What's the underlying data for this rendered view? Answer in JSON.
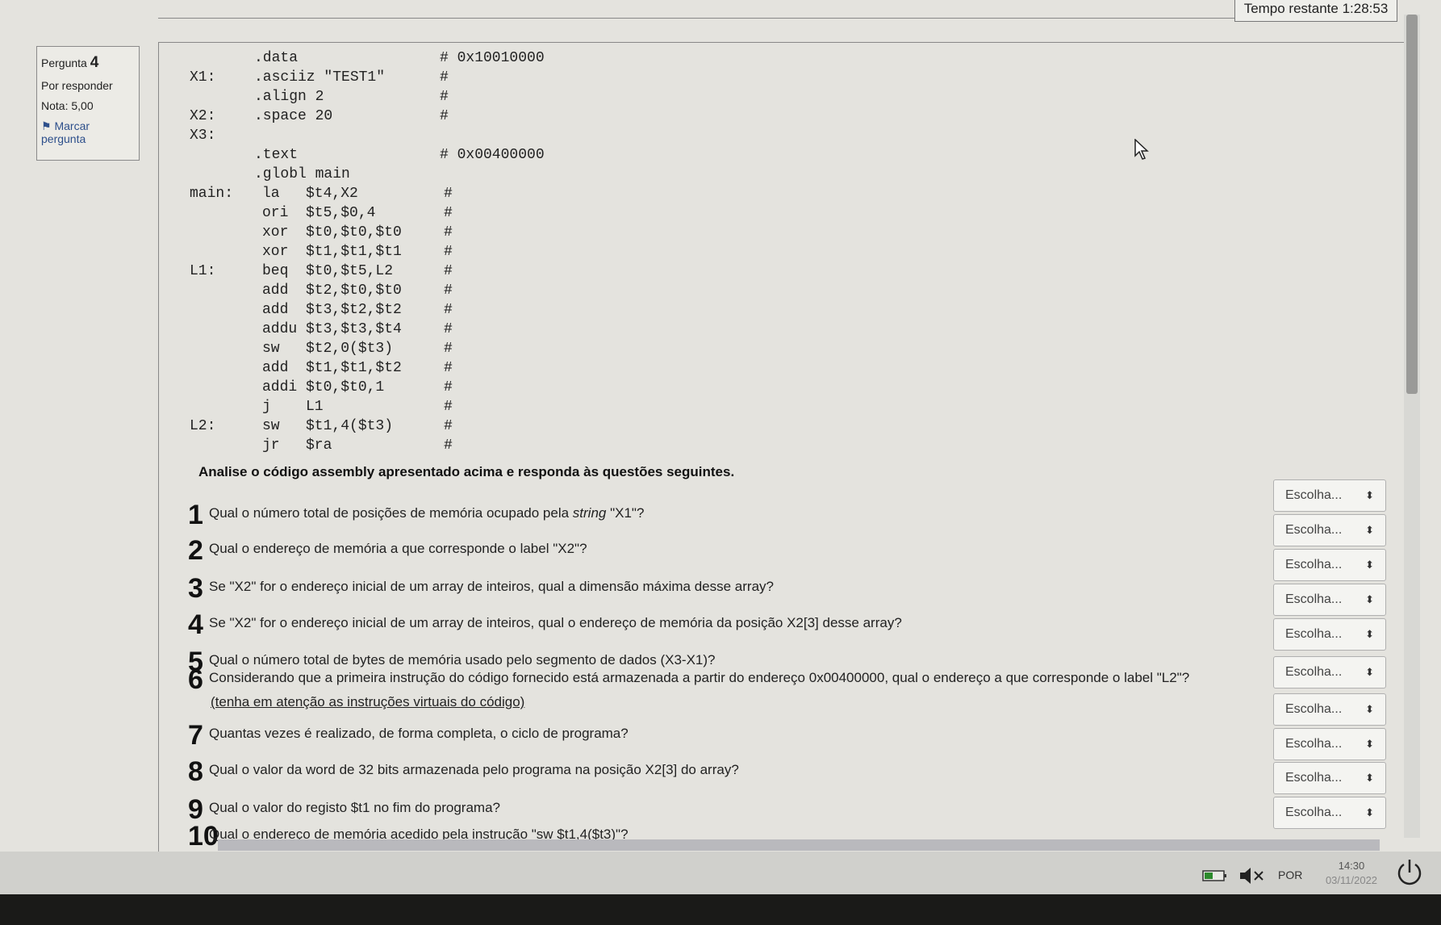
{
  "timer": "Tempo restante 1:28:53",
  "info": {
    "pergunta_label": "Pergunta",
    "pergunta_num": "4",
    "status": "Por responder",
    "nota": "Nota: 5,00",
    "flag_label_1": "Marcar",
    "flag_label_2": "pergunta"
  },
  "code": [
    {
      "label": "",
      "instr": ".data",
      "comment": "# 0x10010000"
    },
    {
      "label": "X1:",
      "instr": ".asciiz \"TEST1\"",
      "comment": "#"
    },
    {
      "label": "",
      "instr": ".align 2",
      "comment": "#"
    },
    {
      "label": "X2:",
      "instr": ".space 20",
      "comment": "#"
    },
    {
      "label": "X3:",
      "instr": "",
      "comment": ""
    },
    {
      "label": "",
      "instr": ".text",
      "comment": "# 0x00400000"
    },
    {
      "label": "",
      "instr": ".globl main",
      "comment": ""
    },
    {
      "label": "main:",
      "instr": "la   $t4,X2",
      "comment": "#"
    },
    {
      "label": "",
      "instr": "ori  $t5,$0,4",
      "comment": "#"
    },
    {
      "label": "",
      "instr": "xor  $t0,$t0,$t0",
      "comment": "#"
    },
    {
      "label": "",
      "instr": "xor  $t1,$t1,$t1",
      "comment": "#"
    },
    {
      "label": "L1:",
      "instr": "beq  $t0,$t5,L2",
      "comment": "#"
    },
    {
      "label": "",
      "instr": "add  $t2,$t0,$t0",
      "comment": "#"
    },
    {
      "label": "",
      "instr": "add  $t3,$t2,$t2",
      "comment": "#"
    },
    {
      "label": "",
      "instr": "addu $t3,$t3,$t4",
      "comment": "#"
    },
    {
      "label": "",
      "instr": "sw   $t2,0($t3)",
      "comment": "#"
    },
    {
      "label": "",
      "instr": "add  $t1,$t1,$t2",
      "comment": "#"
    },
    {
      "label": "",
      "instr": "addi $t0,$t0,1",
      "comment": "#"
    },
    {
      "label": "",
      "instr": "j    L1",
      "comment": "#"
    },
    {
      "label": "L2:",
      "instr": "sw   $t1,4($t3)",
      "comment": "#"
    },
    {
      "label": "",
      "instr": "jr   $ra",
      "comment": "#"
    }
  ],
  "prompt": "Analise o código assembly apresentado acima e responda às questões seguintes.",
  "questions": [
    {
      "n": "1",
      "pre": "Qual o número total de posições de memória ocupado pela ",
      "em": "string",
      "post": " \"X1\"?"
    },
    {
      "n": "2",
      "text": "Qual o endereço de memória a que corresponde o label \"X2\"?"
    },
    {
      "n": "3",
      "text": "Se \"X2\" for o endereço inicial de um array de inteiros, qual a dimensão máxima desse array?"
    },
    {
      "n": "4",
      "text": "Se \"X2\" for o endereço inicial de um array de inteiros, qual o endereço de memória da posição X2[3] desse array?"
    },
    {
      "n": "5",
      "text": "Qual o número total de bytes de memória usado pelo segmento de dados (X3-X1)?"
    },
    {
      "n": "6",
      "text": "Considerando que a primeira instrução do código fornecido está armazenada a partir do endereço 0x00400000, qual o endereço a que corresponde o label \"L2\"?",
      "sub": "(tenha em atenção as instruções virtuais do código)"
    },
    {
      "n": "7",
      "text": "Quantas vezes é realizado, de forma completa, o ciclo de programa?"
    },
    {
      "n": "8",
      "text": "Qual o valor da word de 32 bits armazenada pelo programa na posição X2[3] do array?"
    },
    {
      "n": "9",
      "text": "Qual o valor do registo $t1 no fim do programa?"
    },
    {
      "n": "10",
      "text": "Qual o endereço de memória acedido pela instrução \"sw $t1,4($t3)\"?"
    }
  ],
  "select_placeholder": "Escolha...",
  "taskbar": {
    "lang": "POR",
    "time": "14:30",
    "date": "03/11/2022"
  }
}
